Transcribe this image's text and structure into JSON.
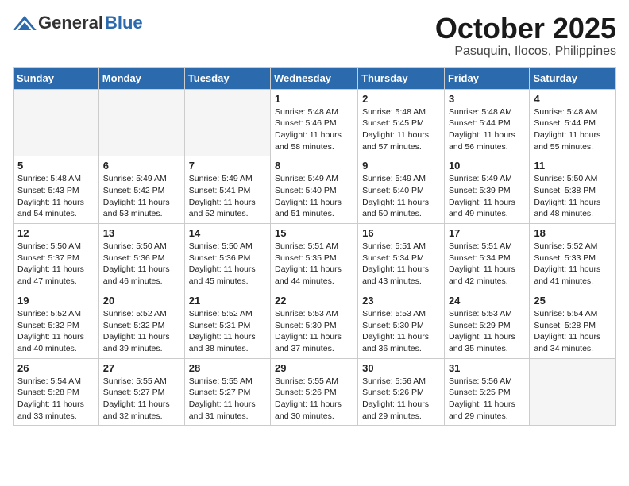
{
  "header": {
    "logo_general": "General",
    "logo_blue": "Blue",
    "month": "October 2025",
    "location": "Pasuquin, Ilocos, Philippines"
  },
  "weekdays": [
    "Sunday",
    "Monday",
    "Tuesday",
    "Wednesday",
    "Thursday",
    "Friday",
    "Saturday"
  ],
  "weeks": [
    [
      {
        "day": "",
        "info": ""
      },
      {
        "day": "",
        "info": ""
      },
      {
        "day": "",
        "info": ""
      },
      {
        "day": "1",
        "info": "Sunrise: 5:48 AM\nSunset: 5:46 PM\nDaylight: 11 hours\nand 58 minutes."
      },
      {
        "day": "2",
        "info": "Sunrise: 5:48 AM\nSunset: 5:45 PM\nDaylight: 11 hours\nand 57 minutes."
      },
      {
        "day": "3",
        "info": "Sunrise: 5:48 AM\nSunset: 5:44 PM\nDaylight: 11 hours\nand 56 minutes."
      },
      {
        "day": "4",
        "info": "Sunrise: 5:48 AM\nSunset: 5:44 PM\nDaylight: 11 hours\nand 55 minutes."
      }
    ],
    [
      {
        "day": "5",
        "info": "Sunrise: 5:48 AM\nSunset: 5:43 PM\nDaylight: 11 hours\nand 54 minutes."
      },
      {
        "day": "6",
        "info": "Sunrise: 5:49 AM\nSunset: 5:42 PM\nDaylight: 11 hours\nand 53 minutes."
      },
      {
        "day": "7",
        "info": "Sunrise: 5:49 AM\nSunset: 5:41 PM\nDaylight: 11 hours\nand 52 minutes."
      },
      {
        "day": "8",
        "info": "Sunrise: 5:49 AM\nSunset: 5:40 PM\nDaylight: 11 hours\nand 51 minutes."
      },
      {
        "day": "9",
        "info": "Sunrise: 5:49 AM\nSunset: 5:40 PM\nDaylight: 11 hours\nand 50 minutes."
      },
      {
        "day": "10",
        "info": "Sunrise: 5:49 AM\nSunset: 5:39 PM\nDaylight: 11 hours\nand 49 minutes."
      },
      {
        "day": "11",
        "info": "Sunrise: 5:50 AM\nSunset: 5:38 PM\nDaylight: 11 hours\nand 48 minutes."
      }
    ],
    [
      {
        "day": "12",
        "info": "Sunrise: 5:50 AM\nSunset: 5:37 PM\nDaylight: 11 hours\nand 47 minutes."
      },
      {
        "day": "13",
        "info": "Sunrise: 5:50 AM\nSunset: 5:36 PM\nDaylight: 11 hours\nand 46 minutes."
      },
      {
        "day": "14",
        "info": "Sunrise: 5:50 AM\nSunset: 5:36 PM\nDaylight: 11 hours\nand 45 minutes."
      },
      {
        "day": "15",
        "info": "Sunrise: 5:51 AM\nSunset: 5:35 PM\nDaylight: 11 hours\nand 44 minutes."
      },
      {
        "day": "16",
        "info": "Sunrise: 5:51 AM\nSunset: 5:34 PM\nDaylight: 11 hours\nand 43 minutes."
      },
      {
        "day": "17",
        "info": "Sunrise: 5:51 AM\nSunset: 5:34 PM\nDaylight: 11 hours\nand 42 minutes."
      },
      {
        "day": "18",
        "info": "Sunrise: 5:52 AM\nSunset: 5:33 PM\nDaylight: 11 hours\nand 41 minutes."
      }
    ],
    [
      {
        "day": "19",
        "info": "Sunrise: 5:52 AM\nSunset: 5:32 PM\nDaylight: 11 hours\nand 40 minutes."
      },
      {
        "day": "20",
        "info": "Sunrise: 5:52 AM\nSunset: 5:32 PM\nDaylight: 11 hours\nand 39 minutes."
      },
      {
        "day": "21",
        "info": "Sunrise: 5:52 AM\nSunset: 5:31 PM\nDaylight: 11 hours\nand 38 minutes."
      },
      {
        "day": "22",
        "info": "Sunrise: 5:53 AM\nSunset: 5:30 PM\nDaylight: 11 hours\nand 37 minutes."
      },
      {
        "day": "23",
        "info": "Sunrise: 5:53 AM\nSunset: 5:30 PM\nDaylight: 11 hours\nand 36 minutes."
      },
      {
        "day": "24",
        "info": "Sunrise: 5:53 AM\nSunset: 5:29 PM\nDaylight: 11 hours\nand 35 minutes."
      },
      {
        "day": "25",
        "info": "Sunrise: 5:54 AM\nSunset: 5:28 PM\nDaylight: 11 hours\nand 34 minutes."
      }
    ],
    [
      {
        "day": "26",
        "info": "Sunrise: 5:54 AM\nSunset: 5:28 PM\nDaylight: 11 hours\nand 33 minutes."
      },
      {
        "day": "27",
        "info": "Sunrise: 5:55 AM\nSunset: 5:27 PM\nDaylight: 11 hours\nand 32 minutes."
      },
      {
        "day": "28",
        "info": "Sunrise: 5:55 AM\nSunset: 5:27 PM\nDaylight: 11 hours\nand 31 minutes."
      },
      {
        "day": "29",
        "info": "Sunrise: 5:55 AM\nSunset: 5:26 PM\nDaylight: 11 hours\nand 30 minutes."
      },
      {
        "day": "30",
        "info": "Sunrise: 5:56 AM\nSunset: 5:26 PM\nDaylight: 11 hours\nand 29 minutes."
      },
      {
        "day": "31",
        "info": "Sunrise: 5:56 AM\nSunset: 5:25 PM\nDaylight: 11 hours\nand 29 minutes."
      },
      {
        "day": "",
        "info": ""
      }
    ]
  ]
}
